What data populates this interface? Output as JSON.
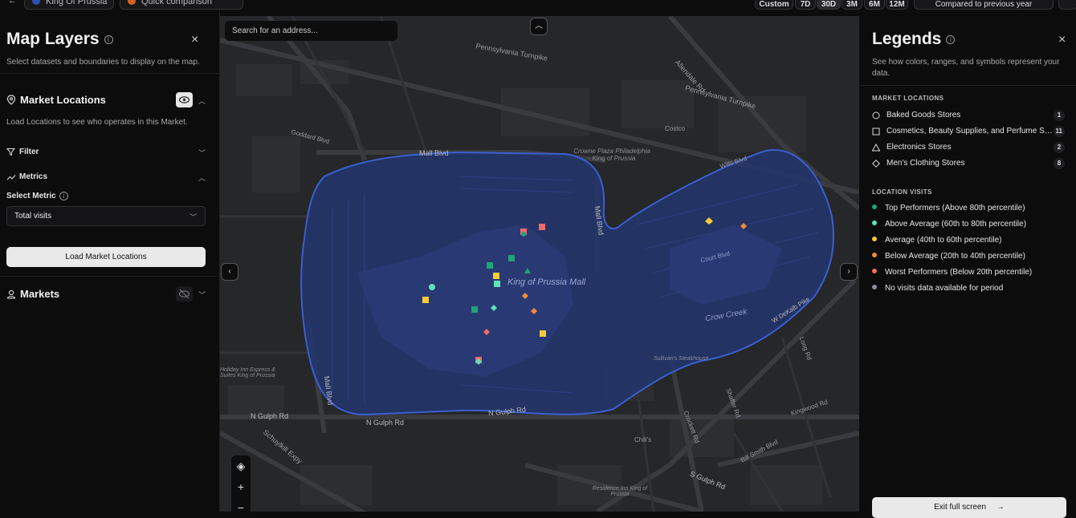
{
  "topbar": {
    "market_pill": "King Of Prussia",
    "comparison_pill": "Quick comparison",
    "periods": [
      "Custom",
      "7D",
      "30D",
      "3M",
      "6M",
      "12M"
    ],
    "compare_select": "Compared to previous year"
  },
  "left_panel": {
    "title": "Map Layers",
    "subtitle": "Select datasets and boundaries to display on the map.",
    "market_locations": {
      "heading": "Market Locations",
      "description": "Load Locations to see who operates in this Market."
    },
    "filter_label": "Filter",
    "metrics_label": "Metrics",
    "select_metric_label": "Select Metric",
    "metric_value": "Total visits",
    "load_button": "Load Market Locations",
    "markets_heading": "Markets"
  },
  "map": {
    "search_placeholder": "Search for an address...",
    "labels": {
      "pa_turnpike_1": "Pennsylvania Turnpike",
      "pa_turnpike_2": "Pennsylvania Turnpike",
      "allendale_rd": "Allendale Rd",
      "mall_blvd_top": "Mall Blvd",
      "mall_blvd_vertical": "Mall Blvd",
      "mall_blvd_left": "Mall Blvd",
      "goddard_blvd": "Goddard Blvd",
      "crowne_plaza": "Crowne Plaza Philadelphia - King of Prussia",
      "costco": "Costco",
      "wills_blvd": "Wills Blvd",
      "court_blvd": "Court Blvd",
      "kop_mall": "King of Prussia Mall",
      "crow_creek": "Crow Creek",
      "w_dekalb_pike": "W DeKalb Pike",
      "sullivans": "Sullivan's Steakhouse",
      "holiday_inn": "Holiday Inn Express & Suites King of Prussia",
      "n_gulph_rd_left": "N Gulph Rd",
      "n_gulph_rd_mid": "N Gulph Rd",
      "n_gulph_rd_right": "N Gulph Rd",
      "schuylkill": "Schuylkill Expy",
      "chilis": "Chili's",
      "bill_smith": "Bill Smith Blvd",
      "s_gulph_rd": "S Gulph Rd",
      "residence_inn": "Residence Inn King of Prussia",
      "kingwood_rd": "Kingwood Rd",
      "long_rd": "Long Rd",
      "shaffer_rd": "Shaffer Rd",
      "crockett_rd": "Crockett Rd"
    },
    "colors": {
      "top": "#1fa37a",
      "above_avg": "#5fe3b7",
      "average": "#f5cb3b",
      "below_avg": "#f08a3c",
      "worst": "#ef6b6b",
      "boundary_fill": "#23366f",
      "boundary_stroke": "#3a5fd0"
    }
  },
  "legend": {
    "title": "Legends",
    "subtitle": "See how colors, ranges, and symbols represent your data.",
    "market_locations_heading": "MARKET LOCATIONS",
    "categories": [
      {
        "symbol": "circle-icon",
        "label": "Baked Goods Stores",
        "count": "1"
      },
      {
        "symbol": "square-icon",
        "label": "Cosmetics, Beauty Supplies, and Perfume Stores",
        "count": "11"
      },
      {
        "symbol": "triangle-icon",
        "label": "Electronics Stores",
        "count": "2"
      },
      {
        "symbol": "diamond-icon",
        "label": "Men's Clothing Stores",
        "count": "8"
      }
    ],
    "location_visits_heading": "LOCATION VISITS",
    "visits": [
      {
        "color": "#1fa37a",
        "label": "Top Performers (Above 80th percentile)"
      },
      {
        "color": "#5fe3b7",
        "label": "Above Average (60th to 80th percentile)"
      },
      {
        "color": "#f5cb3b",
        "label": "Average (40th to 60th percentile)"
      },
      {
        "color": "#f08a3c",
        "label": "Below Average (20th to 40th percentile)"
      },
      {
        "color": "#ef6b6b",
        "label": "Worst Performers (Below 20th percentile)"
      },
      {
        "color": "#8a8f9c",
        "label": "No visits data available for period"
      }
    ],
    "exit_button": "Exit full screen"
  }
}
